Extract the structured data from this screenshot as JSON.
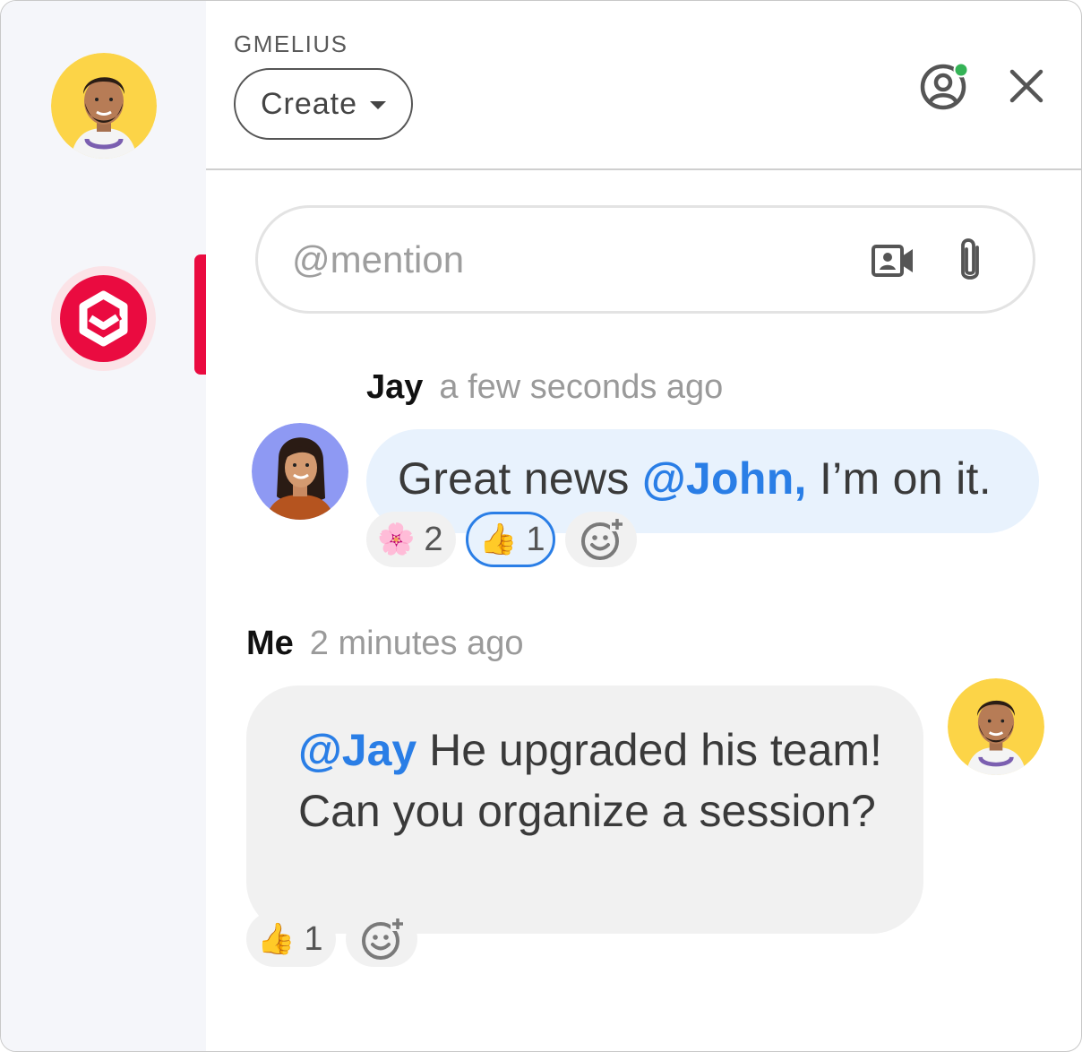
{
  "sidebar": {
    "app_name": "Gmelius",
    "app_color": "#ea0b40"
  },
  "header": {
    "brand": "GMELIUS",
    "create_label": "Create",
    "account_status_color": "#34b356"
  },
  "composer": {
    "placeholder": "@mention",
    "icons": [
      "video-camera-icon",
      "paperclip-icon"
    ]
  },
  "messages": [
    {
      "author": "Jay",
      "time": "a few seconds ago",
      "text_before": "Great news ",
      "mention": "@John,",
      "text_after": " I’m on it.",
      "reactions": [
        {
          "emoji": "🌸",
          "count": "2",
          "selected": false
        },
        {
          "emoji": "👍",
          "count": "1",
          "selected": true
        }
      ]
    },
    {
      "author": "Me",
      "time": "2 minutes ago",
      "mention": "@Jay",
      "text_after": " He upgraded his team! Can you organize a session?",
      "reactions": [
        {
          "emoji": "👍",
          "count": "1",
          "selected": false
        }
      ]
    }
  ],
  "colors": {
    "mention": "#2a7ee6",
    "incoming_bubble": "#e8f2fd",
    "outgoing_bubble": "#f1f1f1"
  }
}
